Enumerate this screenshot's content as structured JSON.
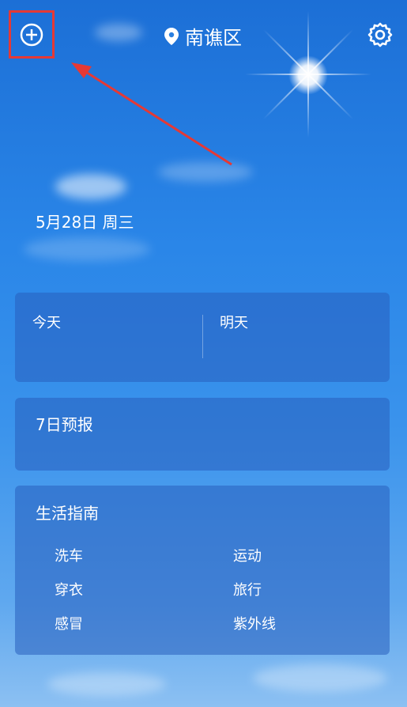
{
  "header": {
    "location": "南谯区",
    "add_icon": "plus-circle-icon",
    "location_icon": "location-pin-icon",
    "settings_icon": "gear-icon"
  },
  "date_text": "5月28日 周三",
  "today_card": {
    "today_label": "今天",
    "tomorrow_label": "明天"
  },
  "forecast_card": {
    "title": "7日预报"
  },
  "life_guide": {
    "title": "生活指南",
    "items": [
      "洗车",
      "运动",
      "穿衣",
      "旅行",
      "感冒",
      "紫外线"
    ]
  },
  "colors": {
    "highlight_box": "#e53935",
    "sky_top": "#1c6fd6",
    "card_bg": "rgba(40,95,190,0.55)"
  }
}
